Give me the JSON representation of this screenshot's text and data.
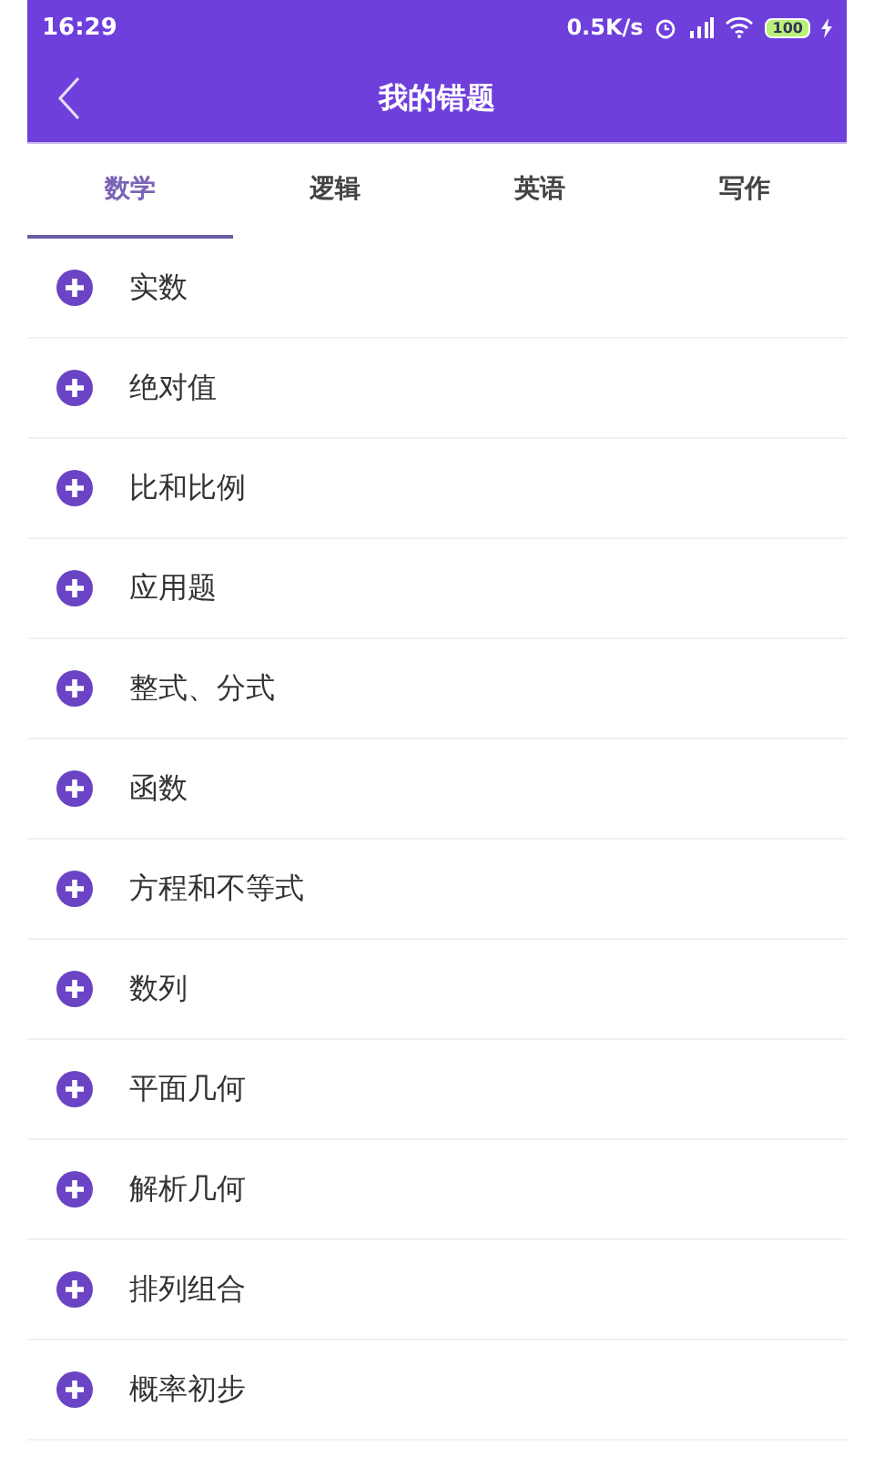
{
  "status_bar": {
    "time": "16:29",
    "speed": "0.5K/s",
    "battery": "100"
  },
  "header": {
    "title": "我的错题"
  },
  "tabs": [
    {
      "label": "数学",
      "selected": true
    },
    {
      "label": "逻辑",
      "selected": false
    },
    {
      "label": "英语",
      "selected": false
    },
    {
      "label": "写作",
      "selected": false
    }
  ],
  "topics": [
    {
      "label": "实数",
      "expanded": false
    },
    {
      "label": "绝对值",
      "expanded": false
    },
    {
      "label": "比和比例",
      "expanded": false
    },
    {
      "label": "应用题",
      "expanded": false
    },
    {
      "label": "整式、分式",
      "expanded": false
    },
    {
      "label": "函数",
      "expanded": false
    },
    {
      "label": "方程和不等式",
      "expanded": false
    },
    {
      "label": "数列",
      "expanded": false
    },
    {
      "label": "平面几何",
      "expanded": false
    },
    {
      "label": "解析几何",
      "expanded": false
    },
    {
      "label": "排列组合",
      "expanded": false
    },
    {
      "label": "概率初步",
      "expanded": false
    }
  ]
}
